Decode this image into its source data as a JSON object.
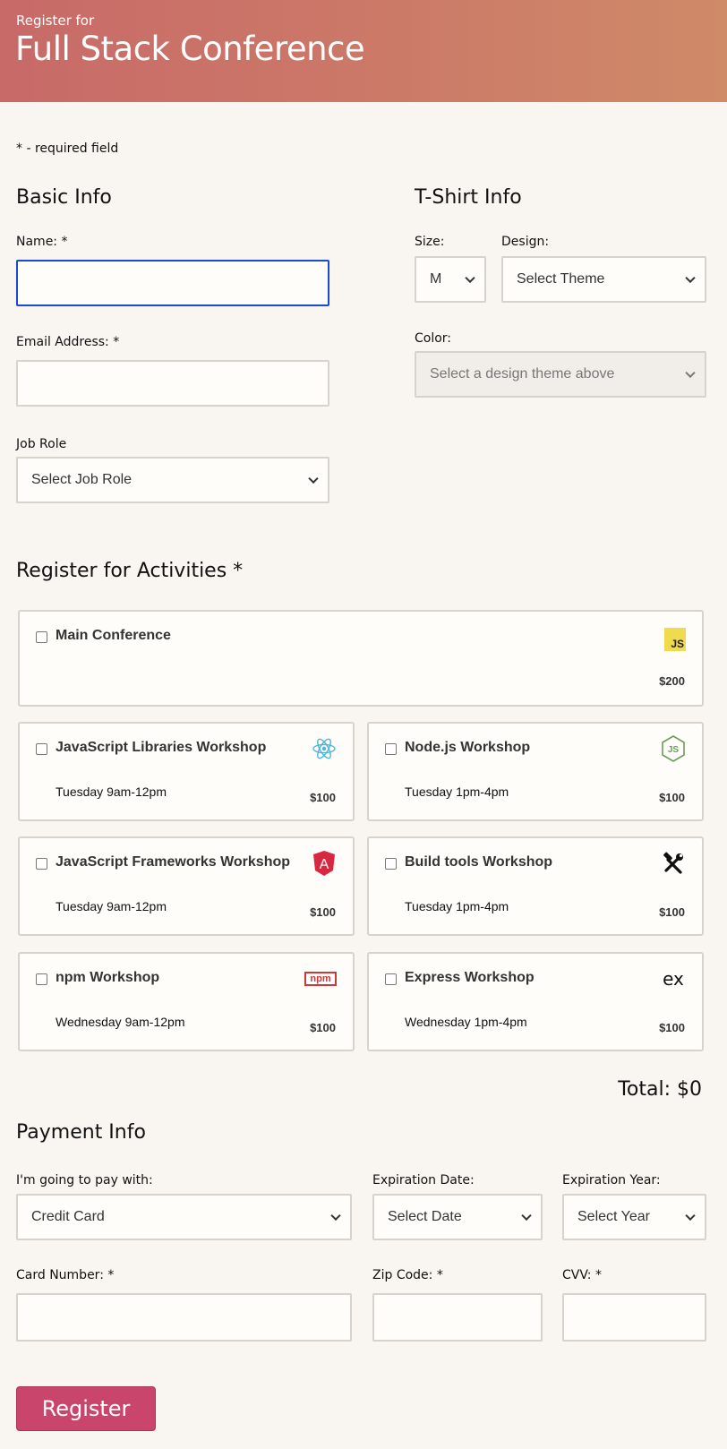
{
  "header": {
    "pre_title": "Register for",
    "title": "Full Stack Conference"
  },
  "required_note": "* - required field",
  "basic_info": {
    "heading": "Basic Info",
    "name_label": "Name: *",
    "email_label": "Email Address: *",
    "job_role_label": "Job Role",
    "job_role_value": "Select Job Role"
  },
  "tshirt": {
    "heading": "T-Shirt Info",
    "size_label": "Size:",
    "size_value": "M",
    "design_label": "Design:",
    "design_value": "Select Theme",
    "color_label": "Color:",
    "color_value": "Select a design theme above"
  },
  "activities": {
    "heading": "Register for Activities *",
    "items": [
      {
        "name": "Main Conference",
        "time": "",
        "price": "$200",
        "icon": "js-icon"
      },
      {
        "name": "JavaScript Libraries Workshop",
        "time": "Tuesday 9am-12pm",
        "price": "$100",
        "icon": "react-icon"
      },
      {
        "name": "Node.js Workshop",
        "time": "Tuesday 1pm-4pm",
        "price": "$100",
        "icon": "nodejs-icon"
      },
      {
        "name": "JavaScript Frameworks Workshop",
        "time": "Tuesday 9am-12pm",
        "price": "$100",
        "icon": "angular-icon"
      },
      {
        "name": "Build tools Workshop",
        "time": "Tuesday 1pm-4pm",
        "price": "$100",
        "icon": "tools-icon"
      },
      {
        "name": "npm Workshop",
        "time": "Wednesday 9am-12pm",
        "price": "$100",
        "icon": "npm-icon"
      },
      {
        "name": "Express Workshop",
        "time": "Wednesday 1pm-4pm",
        "price": "$100",
        "icon": "express-icon"
      }
    ],
    "total": "Total: $0"
  },
  "payment": {
    "heading": "Payment Info",
    "method_label": "I'm going to pay with:",
    "method_value": "Credit Card",
    "exp_date_label": "Expiration Date:",
    "exp_date_value": "Select Date",
    "exp_year_label": "Expiration Year:",
    "exp_year_value": "Select Year",
    "card_label": "Card Number: *",
    "zip_label": "Zip Code: *",
    "cvv_label": "CVV: *"
  },
  "submit_label": "Register",
  "icon_text": {
    "js": "JS",
    "express": "ex",
    "npm": "npm",
    "angular": "A"
  },
  "colors": {
    "header_start": "#c86a68",
    "header_end": "#cf8a68",
    "button": "#c9456c",
    "focus_border": "#1a4ad2"
  }
}
